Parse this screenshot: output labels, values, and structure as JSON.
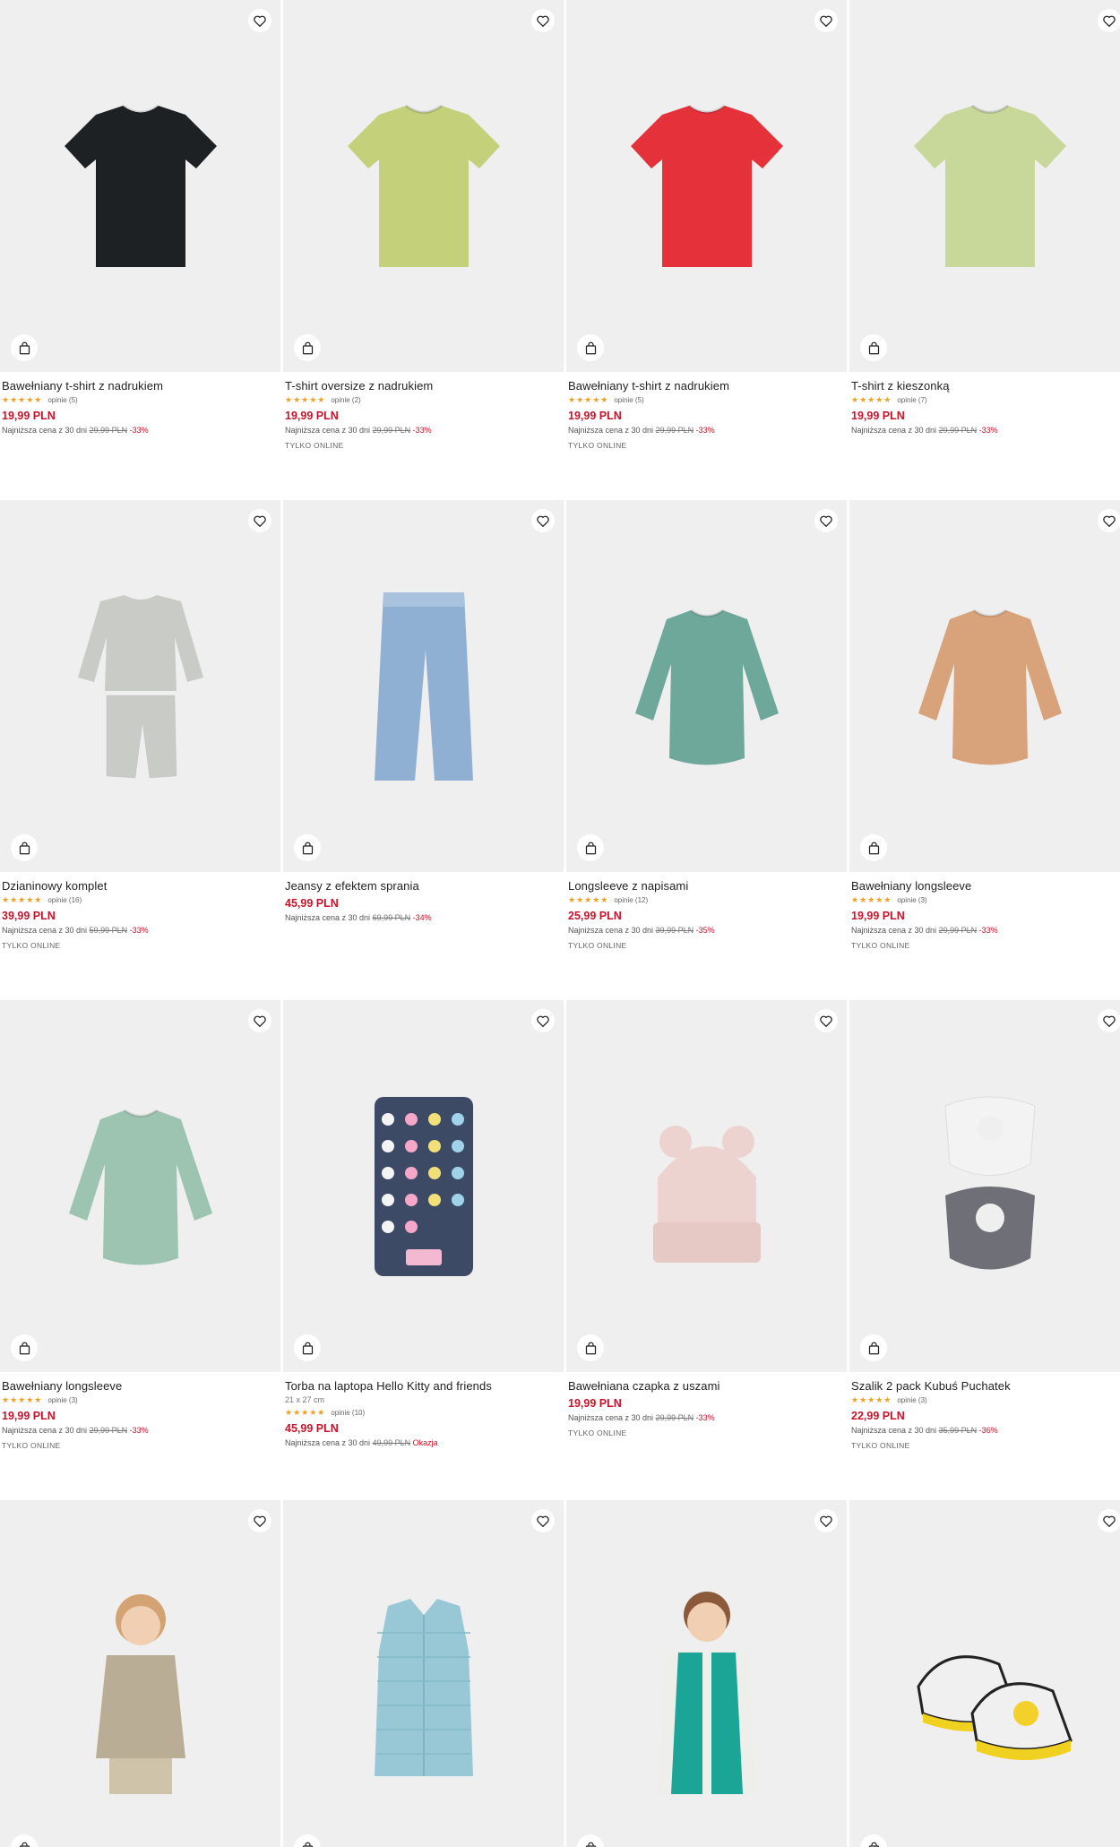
{
  "products": [
    {
      "name": "Bawełniany t-shirt z nadrukiem",
      "stars": "★★★★★",
      "reviews": "opinie (5)",
      "price": "19,99 PLN",
      "lowest_label": "Najniższa cena z 30 dni",
      "old_price": "29,99 PLN",
      "discount": "-33%",
      "badge": "",
      "art": "tshirt",
      "color": "#1e2124"
    },
    {
      "name": "T-shirt oversize z nadrukiem",
      "stars": "★★★★★",
      "reviews": "opinie (2)",
      "price": "19,99 PLN",
      "lowest_label": "Najniższa cena z 30 dni",
      "old_price": "29,99 PLN",
      "discount": "-33%",
      "badge": "TYLKO ONLINE",
      "art": "tshirt",
      "color": "#c5d07a"
    },
    {
      "name": "Bawełniany t-shirt z nadrukiem",
      "stars": "★★★★★",
      "reviews": "opinie (5)",
      "price": "19,99 PLN",
      "lowest_label": "Najniższa cena z 30 dni",
      "old_price": "29,99 PLN",
      "discount": "-33%",
      "badge": "TYLKO ONLINE",
      "art": "tshirt",
      "color": "#e5323a"
    },
    {
      "name": "T-shirt z kieszonką",
      "stars": "★★★★★",
      "reviews": "opinie (7)",
      "price": "19,99 PLN",
      "lowest_label": "Najniższa cena z 30 dni",
      "old_price": "29,99 PLN",
      "discount": "-33%",
      "badge": "",
      "art": "tshirt",
      "color": "#c8d89a"
    },
    {
      "name": "Dzianinowy komplet",
      "stars": "★★★★★",
      "reviews": "opinie (16)",
      "price": "39,99 PLN",
      "lowest_label": "Najniższa cena z 30 dni",
      "old_price": "59,99 PLN",
      "discount": "-33%",
      "badge": "TYLKO ONLINE",
      "art": "set",
      "color": "#c9cbc6"
    },
    {
      "name": "Jeansy z efektem sprania",
      "stars": "",
      "reviews": "",
      "price": "45,99 PLN",
      "lowest_label": "Najniższa cena z 30 dni",
      "old_price": "69,99 PLN",
      "discount": "-34%",
      "badge": "",
      "art": "jeans",
      "color": "#8fb0d2"
    },
    {
      "name": "Longsleeve z napisami",
      "stars": "★★★★★",
      "reviews": "opinie (12)",
      "price": "25,99 PLN",
      "lowest_label": "Najniższa cena z 30 dni",
      "old_price": "39,99 PLN",
      "discount": "-35%",
      "badge": "TYLKO ONLINE",
      "art": "longsleeve",
      "color": "#6ea89a"
    },
    {
      "name": "Bawełniany longsleeve",
      "stars": "★★★★★",
      "reviews": "opinie (3)",
      "price": "19,99 PLN",
      "lowest_label": "Najniższa cena z 30 dni",
      "old_price": "29,99 PLN",
      "discount": "-33%",
      "badge": "TYLKO ONLINE",
      "art": "longsleeve",
      "color": "#d8a27a"
    },
    {
      "name": "Bawełniany longsleeve",
      "stars": "★★★★★",
      "reviews": "opinie (3)",
      "price": "19,99 PLN",
      "lowest_label": "Najniższa cena z 30 dni",
      "old_price": "29,99 PLN",
      "discount": "-33%",
      "badge": "TYLKO ONLINE",
      "art": "longsleeve",
      "color": "#9cc4b0"
    },
    {
      "name": "Torba na laptopa Hello Kitty and friends",
      "size": "21 x 27 cm",
      "stars": "★★★★★",
      "reviews": "opinie (10)",
      "price": "45,99 PLN",
      "lowest_label": "Najniższa cena z 30 dni",
      "old_price": "49,99 PLN",
      "discount": "Okazja",
      "badge": "",
      "art": "bag",
      "color": "#3d4a66"
    },
    {
      "name": "Bawełniana czapka z uszami",
      "stars": "",
      "reviews": "",
      "price": "19,99 PLN",
      "lowest_label": "Najniższa cena z 30 dni",
      "old_price": "29,99 PLN",
      "discount": "-33%",
      "badge": "TYLKO ONLINE",
      "art": "hat",
      "color": "#ecd3cf"
    },
    {
      "name": "Szalik 2 pack Kubuś Puchatek",
      "stars": "★★★★★",
      "reviews": "opinie (3)",
      "price": "22,99 PLN",
      "lowest_label": "Najniższa cena z 30 dni",
      "old_price": "35,99 PLN",
      "discount": "-36%",
      "badge": "TYLKO ONLINE",
      "art": "bibs",
      "color": "#6f6f78"
    },
    {
      "name": "",
      "art": "kid-jacket",
      "color": "#b9ad96"
    },
    {
      "name": "",
      "art": "vest",
      "color": "#98c8d6"
    },
    {
      "name": "",
      "art": "kid-vest",
      "color": "#1aa596"
    },
    {
      "name": "",
      "art": "shoes",
      "color": "#f0d020"
    }
  ],
  "icons": {
    "favorite": "heart-icon",
    "cart": "shopping-bag-icon"
  }
}
